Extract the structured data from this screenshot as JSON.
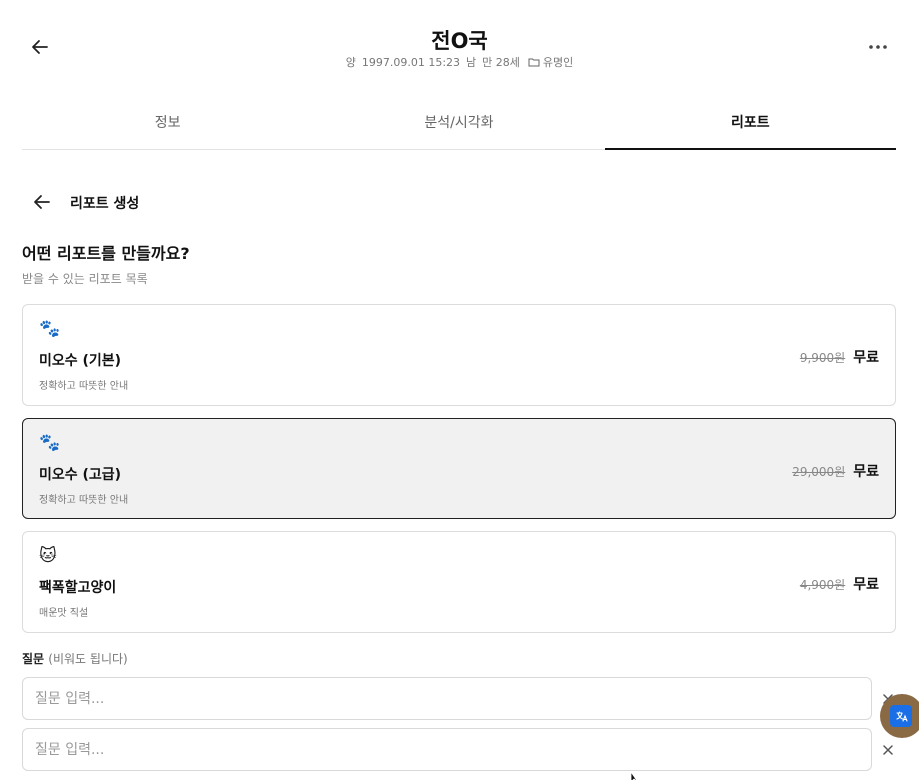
{
  "header": {
    "title": "전O국",
    "calendar_type": "양",
    "birth": "1997.09.01 15:23",
    "gender": "남",
    "age": "만 28세",
    "group": "유명인"
  },
  "tabs": [
    {
      "label": "정보",
      "active": false
    },
    {
      "label": "분석/시각화",
      "active": false
    },
    {
      "label": "리포트",
      "active": true
    }
  ],
  "section": {
    "title": "리포트 생성",
    "question": "어떤 리포트를 만들까요?",
    "subtitle": "받을 수 있는 리포트 목록"
  },
  "reports": [
    {
      "emoji": "🐾",
      "name": "미오수 (기본)",
      "desc": "정확하고 따뜻한 안내",
      "old_price": "9,900원",
      "price": "무료",
      "selected": false
    },
    {
      "emoji": "🐾",
      "name": "미오수 (고급)",
      "desc": "정확하고 따뜻한 안내",
      "old_price": "29,000원",
      "price": "무료",
      "selected": true
    },
    {
      "emoji": "🐱",
      "name": "팩폭할고양이",
      "desc": "매운맛 직설",
      "old_price": "4,900원",
      "price": "무료",
      "selected": false
    }
  ],
  "questions": {
    "label": "질문",
    "hint": "(비워도 됩니다)",
    "placeholder": "질문 입력...",
    "inputs": [
      "",
      ""
    ]
  },
  "icons": {
    "back": "arrow-left-icon",
    "more": "more-horizontal-icon",
    "folder": "folder-icon",
    "clear": "close-icon"
  },
  "colors": {
    "fab_bg": "#8a6a45",
    "fab_inner": "#1a6ee6",
    "selected_bg": "#f1f1f1"
  }
}
